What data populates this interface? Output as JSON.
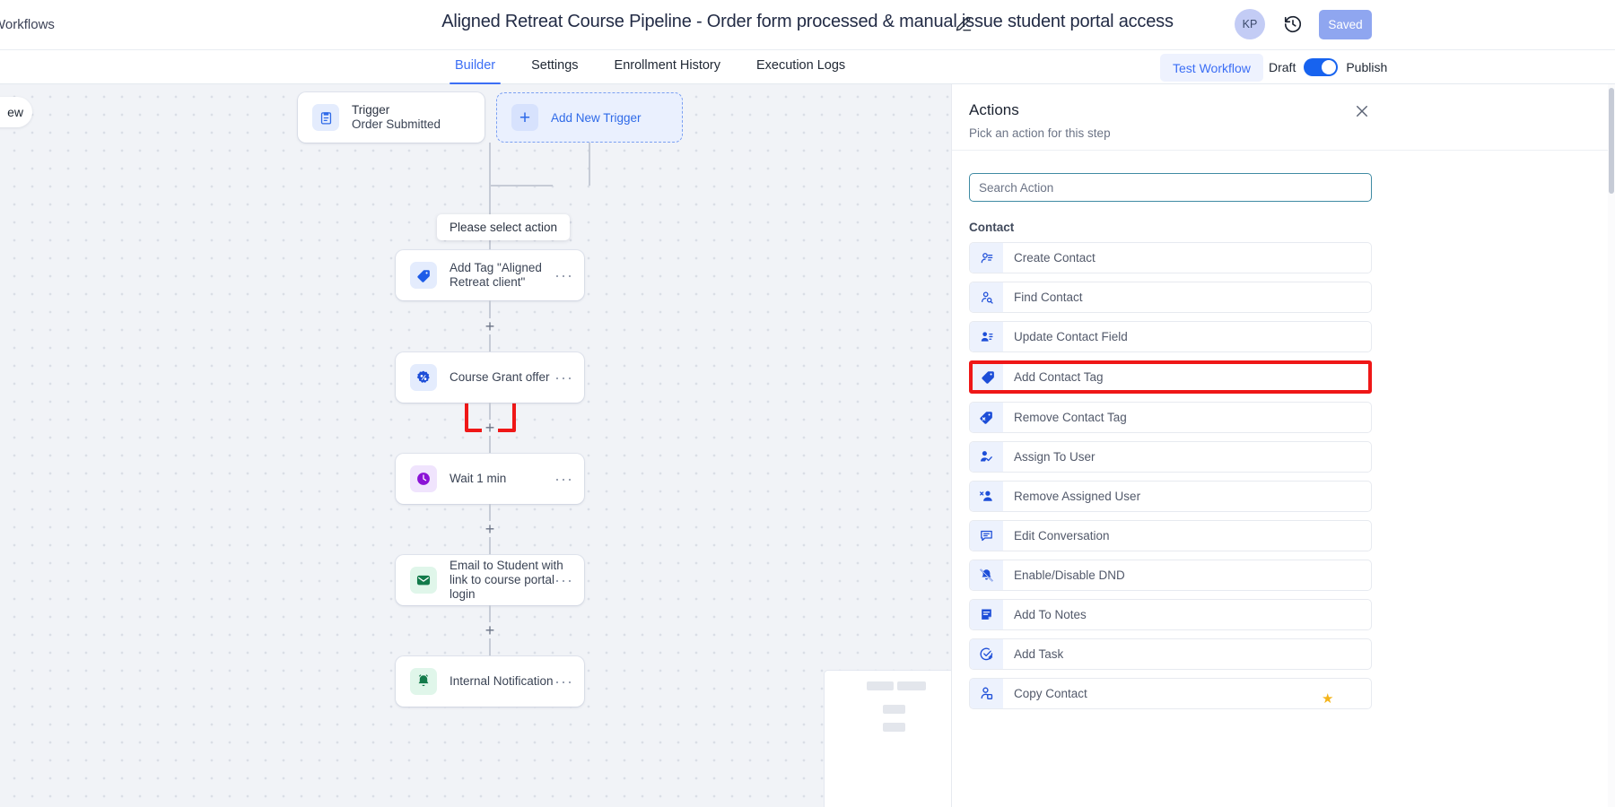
{
  "topbar": {
    "breadcrumb": "Workflows",
    "title": "Aligned Retreat Course Pipeline - Order form processed & manual issue student portal access",
    "edit_icon": "pencil-icon",
    "avatar_initials": "KP",
    "history_icon": "history-clock-icon",
    "save_status": "Saved"
  },
  "tabbar": {
    "tabs": [
      {
        "label": "Builder",
        "active": true
      },
      {
        "label": "Settings",
        "active": false
      },
      {
        "label": "Enrollment History",
        "active": false
      },
      {
        "label": "Execution Logs",
        "active": false
      }
    ],
    "test_workflow": "Test Workflow",
    "draft_label": "Draft",
    "publish_label": "Publish",
    "toggle_on": true
  },
  "canvas": {
    "left_pill": "ew",
    "tooltip": "Please select action",
    "add_trigger": {
      "label": "Add New Trigger",
      "icon": "plus-icon"
    },
    "nodes": [
      {
        "title": "Trigger",
        "subtitle": "Order Submitted",
        "icon": "clipboard-icon",
        "icon_bg": "#e4ecfd",
        "icon_color": "#2f6ae8"
      },
      {
        "title": "Add Tag \"Aligned Retreat client\"",
        "icon": "tag-icon",
        "icon_bg": "#e4ecfd",
        "icon_color": "#1d5ce8"
      },
      {
        "title": "Course Grant offer",
        "icon": "percent-badge-icon",
        "icon_bg": "#e4ecfd",
        "icon_color": "#1d4ed8"
      },
      {
        "title": "Wait 1 min",
        "icon": "clock-icon",
        "icon_bg": "#f0e4fd",
        "icon_color": "#8b12d6"
      },
      {
        "title": "Email to Student with link to course portal login",
        "icon": "mail-icon",
        "icon_bg": "#e0f6ea",
        "icon_color": "#127a4a"
      },
      {
        "title": "Internal Notification",
        "icon": "bell-icon",
        "icon_bg": "#e0f6ea",
        "icon_color": "#127a4a"
      }
    ],
    "plus_label": "+",
    "highlight_color": "#ef1717"
  },
  "panel": {
    "title": "Actions",
    "subtitle": "Pick an action for this step",
    "close_icon": "close-icon",
    "search_placeholder": "Search Action",
    "search_value": "",
    "group_label": "Contact",
    "actions": [
      {
        "label": "Create Contact",
        "icon": "contact-add-icon",
        "selected": false
      },
      {
        "label": "Find Contact",
        "icon": "contact-search-icon",
        "selected": false
      },
      {
        "label": "Update Contact Field",
        "icon": "contact-edit-icon",
        "selected": false
      },
      {
        "label": "Add Contact Tag",
        "icon": "tag-icon",
        "selected": true
      },
      {
        "label": "Remove Contact Tag",
        "icon": "tag-remove-icon",
        "selected": false
      },
      {
        "label": "Assign To User",
        "icon": "user-check-icon",
        "selected": false
      },
      {
        "label": "Remove Assigned User",
        "icon": "user-remove-icon",
        "selected": false
      },
      {
        "label": "Edit Conversation",
        "icon": "conversation-icon",
        "selected": false
      },
      {
        "label": "Enable/Disable DND",
        "icon": "bell-off-icon",
        "selected": false
      },
      {
        "label": "Add To Notes",
        "icon": "note-icon",
        "selected": false
      },
      {
        "label": "Add Task",
        "icon": "task-check-icon",
        "selected": false
      },
      {
        "label": "Copy Contact",
        "icon": "contact-copy-icon",
        "selected": false
      }
    ]
  },
  "colors": {
    "accent": "#3b6ef5",
    "highlight": "#ef1717",
    "panel_bg": "#ffffff",
    "canvas_bg": "#f1f3f7"
  }
}
